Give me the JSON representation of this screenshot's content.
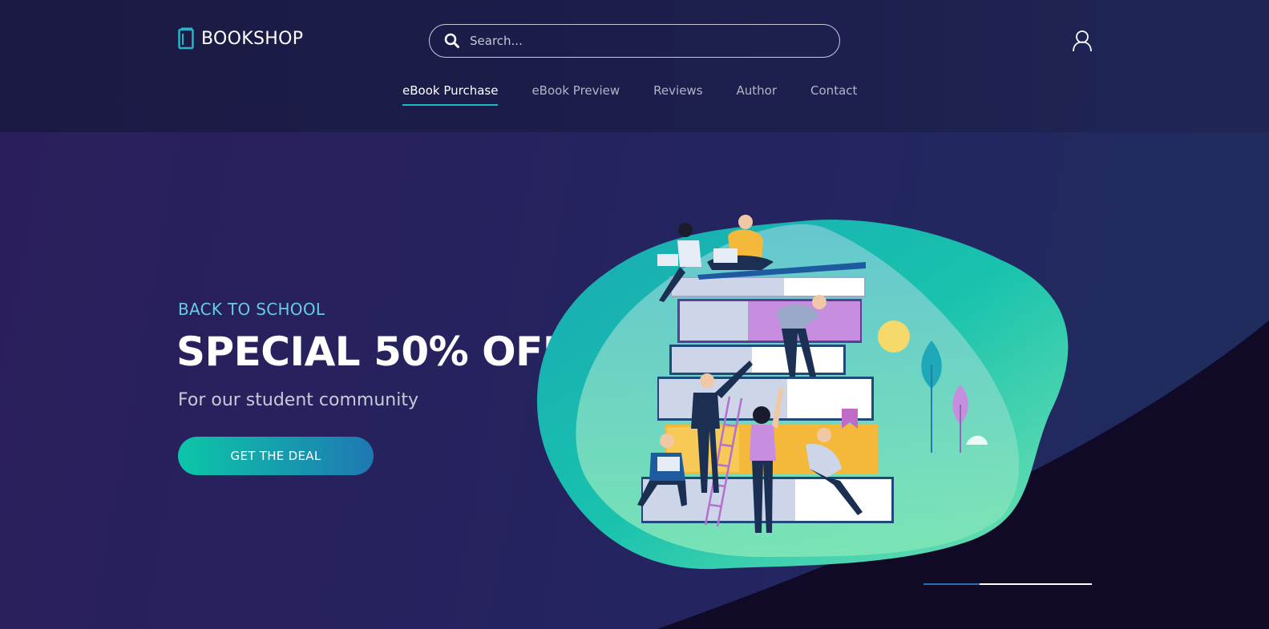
{
  "header": {
    "logo_text": "BOOKSHOP",
    "search": {
      "placeholder": "Search..."
    },
    "nav": [
      {
        "label": "eBook Purchase",
        "active": true
      },
      {
        "label": "eBook Preview",
        "active": false
      },
      {
        "label": "Reviews",
        "active": false
      },
      {
        "label": "Author",
        "active": false
      },
      {
        "label": "Contact",
        "active": false
      }
    ]
  },
  "hero": {
    "eyebrow": "BACK TO SCHOOL",
    "headline": "SPECIAL 50% OFF",
    "subline": "For our student community",
    "cta_label": "GET THE DEAL",
    "slider": {
      "active_index": 0,
      "total": 3
    }
  },
  "colors": {
    "accent_teal": "#21b5c2",
    "cta_start": "#0cc6a7",
    "cta_end": "#1f78b3",
    "eyebrow": "#66cde0",
    "background": "#231f5a"
  },
  "icons": [
    "book-logo-icon",
    "search-icon",
    "user-icon"
  ]
}
